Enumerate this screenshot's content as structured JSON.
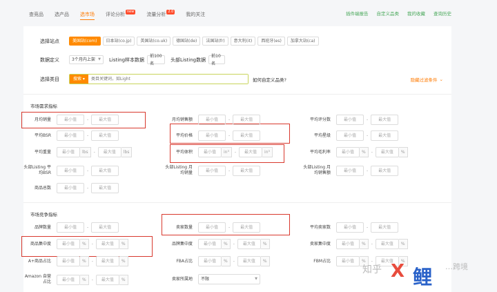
{
  "nav": {
    "tabs": [
      {
        "label": "查竞品",
        "active": false,
        "badge": ""
      },
      {
        "label": "选产品",
        "active": false,
        "badge": ""
      },
      {
        "label": "选市场",
        "active": true,
        "badge": ""
      },
      {
        "label": "评论分析",
        "active": false,
        "badge": "new"
      },
      {
        "label": "流量分析",
        "active": false,
        "badge": "2.0"
      },
      {
        "label": "我的关注",
        "active": false,
        "badge": ""
      }
    ],
    "links": [
      "插件端报告",
      "自定义品类",
      "我的收藏",
      "查询历史"
    ]
  },
  "filters": {
    "site_label": "选择站点",
    "sites": [
      "美国站(com)",
      "日本站(co.jp)",
      "英国站(co.uk)",
      "德国站(de)",
      "法国站(fr)",
      "意大利(it)",
      "西班牙(es)",
      "加拿大站(ca)"
    ],
    "selected_site": "美国站(com)",
    "data_def_label": "数据定义",
    "period_value": "3个月内上架",
    "listing_sample_label": "Listing样本数据",
    "listing_sample_value": "前100名",
    "top_listing_label": "头部Listing数据",
    "top_listing_value": "前10名",
    "category_label": "选择类目",
    "search_btn": "搜索",
    "search_placeholder": "类目关键词，如Light",
    "custom_category_link": "如何自定义品类?",
    "hide_filters": "隐藏过滤条件"
  },
  "demand_section": {
    "title": "市场需求指标",
    "fields": [
      {
        "label": "月均销量",
        "min": "最小值",
        "max": "最大值",
        "unit": ""
      },
      {
        "label": "月均销售额",
        "min": "最小值",
        "max": "最大值",
        "unit": ""
      },
      {
        "label": "平均评分数",
        "min": "最小值",
        "max": "最大值",
        "unit": ""
      },
      {
        "label": "平均BSR",
        "min": "最小值",
        "max": "最大值",
        "unit": ""
      },
      {
        "label": "平均价格",
        "min": "最小值",
        "max": "最大值",
        "unit": ""
      },
      {
        "label": "平均星级",
        "min": "最小值",
        "max": "最大值",
        "unit": ""
      },
      {
        "label": "平均重量",
        "min": "最小值",
        "max": "最大值",
        "unit": "lbs"
      },
      {
        "label": "平均体积",
        "min": "最小值",
        "max": "最大值",
        "unit": "in³"
      },
      {
        "label": "平均毛利率",
        "min": "最小值",
        "max": "最大值",
        "unit": "%"
      },
      {
        "label": "头部Listing 平均BSR",
        "min": "最小值",
        "max": "最大值",
        "unit": ""
      },
      {
        "label": "头部Listing 月均销量",
        "min": "最小值",
        "max": "最大值",
        "unit": ""
      },
      {
        "label": "头部Listing 月均销售额",
        "min": "最小值",
        "max": "最大值",
        "unit": ""
      },
      {
        "label": "商品总数",
        "min": "最小值",
        "max": "最大值",
        "unit": ""
      }
    ]
  },
  "competition_section": {
    "title": "市场竞争指标",
    "fields": [
      {
        "label": "品牌数量",
        "min": "最小值",
        "max": "最大值",
        "unit": ""
      },
      {
        "label": "卖家数量",
        "min": "最小值",
        "max": "最大值",
        "unit": ""
      },
      {
        "label": "平均卖家数",
        "min": "最小值",
        "max": "最大值",
        "unit": ""
      },
      {
        "label": "商品集中度",
        "min": "最小值",
        "max": "最大值",
        "unit": "%"
      },
      {
        "label": "品牌集中度",
        "min": "最小值",
        "max": "最大值",
        "unit": "%"
      },
      {
        "label": "卖家集中度",
        "min": "最小值",
        "max": "最大值",
        "unit": "%"
      },
      {
        "label": "A+商品占比",
        "min": "最小值",
        "max": "最大值",
        "unit": "%"
      },
      {
        "label": "FBA占比",
        "min": "最小值",
        "max": "最大值",
        "unit": "%"
      },
      {
        "label": "FBM占比",
        "min": "最小值",
        "max": "最大值",
        "unit": "%"
      },
      {
        "label": "Amazon 自营占比",
        "min": "最小值",
        "max": "最大值",
        "unit": "%"
      },
      {
        "label": "卖家所属地",
        "select_value": "不限"
      }
    ]
  },
  "watermark": {
    "text": "知乎",
    "x": "X",
    "jia": "鲤",
    "tail": "…跨境"
  }
}
